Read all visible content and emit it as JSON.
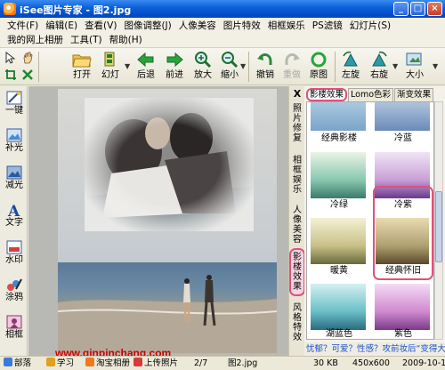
{
  "window": {
    "title": "iSee图片专家 - 图2.jpg",
    "min": "_",
    "max": "□",
    "close": "×"
  },
  "menu": {
    "row1": [
      "文件(F)",
      "编辑(E)",
      "查看(V)",
      "图像调整(J)",
      "人像美容",
      "图片特效",
      "相框娱乐",
      "PS滤镜",
      "幻灯片(S)"
    ],
    "row2": [
      "我的网上相册",
      "工具(T)",
      "帮助(H)"
    ]
  },
  "toolbar": {
    "open": "打开",
    "slideshow": "幻灯",
    "back": "后退",
    "forward": "前进",
    "zoom_in": "放大",
    "zoom_out": "缩小",
    "undo": "撤销",
    "redo": "重做",
    "original": "原图",
    "rotate_left": "左旋",
    "rotate_right": "右旋",
    "size": "大小"
  },
  "left_tools": [
    "一键",
    "补光",
    "减光",
    "文字",
    "水印",
    "涂鸦",
    "相框"
  ],
  "vertical_tabs": {
    "close": "X",
    "items": [
      "照片修复",
      "相框娱乐",
      "人像美容",
      "影楼效果",
      "风格特效"
    ]
  },
  "effects": {
    "tabs": [
      "影楼效果",
      "Lomo色彩",
      "渐变效果"
    ],
    "items": [
      "经典影楼",
      "冷蓝",
      "冷绿",
      "冷紫",
      "暖黄",
      "经典怀旧",
      "湖蓝色",
      "紫色"
    ],
    "selected": "经典怀旧"
  },
  "banner": "忧郁？可爱？性感？攻前妆后“变得大”",
  "watermark": "www.qinpinchang.com",
  "status": {
    "start": "部落",
    "learn": "学习",
    "taobao": "淘宝相册",
    "upload": "上传照片",
    "page": "2/7",
    "filename": "图2.jpg",
    "filesize": "30 KB",
    "dimensions": "450x600",
    "date": "2009-10-1"
  }
}
